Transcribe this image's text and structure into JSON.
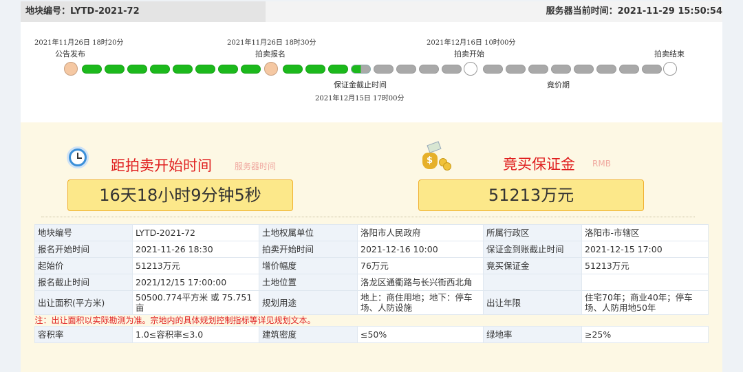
{
  "header": {
    "plot_no_label": "地块编号：LYTD-2021-72",
    "server_time_label": "服务器当前时间：2021-11-29 15:50:54"
  },
  "timeline": {
    "milestones": [
      {
        "date": "2021年11月26日 18时20分",
        "label": "公告发布"
      },
      {
        "date": "2021年11月26日 18时30分",
        "label": "拍卖报名"
      },
      {
        "date": "2021年12月16日 10时00分",
        "label": "拍卖开始"
      },
      {
        "label": "拍卖结束"
      }
    ],
    "deadline_label": "保证金截止时间",
    "deadline_date": "2021年12月15日 17时00分",
    "bidding_period_label": "竟价期"
  },
  "countdown": {
    "title": "距拍卖开始时间",
    "subtitle": "服务器时间",
    "value": "16天18小时9分钟5秒"
  },
  "deposit": {
    "title": "竟买保证金",
    "subtitle": "RMB",
    "value": "51213万元"
  },
  "details": {
    "rows": [
      [
        "地块编号",
        "LYTD-2021-72",
        "土地权属单位",
        "洛阳市人民政府",
        "所属行政区",
        "洛阳市-市辖区"
      ],
      [
        "报名开始时间",
        "2021-11-26 18:30",
        "拍卖开始时间",
        "2021-12-16 10:00",
        "保证金到账截止时间",
        "2021-12-15 17:00"
      ],
      [
        "起始价",
        "51213万元",
        "增价幅度",
        "76万元",
        "竟买保证金",
        "51213万元"
      ],
      [
        "报名截止时间",
        "2021/12/15 17:00:00",
        "土地位置",
        "洛龙区通衢路与长兴街西北角",
        "",
        ""
      ],
      [
        "出让面积(平方米)",
        "50500.774平方米 或 75.751亩",
        "规划用途",
        "地上：商住用地；地下：停车场、人防设施",
        "出让年限",
        "住宅70年；商业40年；停车场、人防用地50年"
      ]
    ],
    "note": "注：出让面积以实际勘测为准。宗地内的具体规划控制指标等详见规划文本。",
    "last_row": [
      "容积率",
      "1.0≤容积率≤3.0",
      "建筑密度",
      "≤50%",
      "绿地率",
      "≥25%"
    ]
  },
  "colors": {
    "progress_done": "#1cb91c",
    "progress_pending": "#a9a9a9",
    "milestone_passed": "#f5c8a3",
    "accent_red": "#e02020",
    "value_box": "#fce88a"
  }
}
